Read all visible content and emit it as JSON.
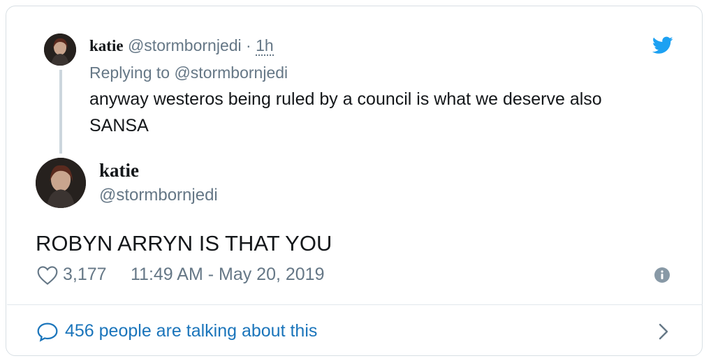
{
  "colors": {
    "brand": "#1da1f2",
    "link": "#1b75bb",
    "muted": "#657786",
    "text": "#14171a",
    "border": "#d8dfe4"
  },
  "quoted": {
    "name": "katie",
    "handle": "@stormbornjedi",
    "separator": "·",
    "time": "1h",
    "replying_to": "Replying to @stormbornjedi",
    "line1": "anyway westeros being ruled by a council is what we deserve also",
    "line2": "SANSA"
  },
  "main": {
    "name": "katie",
    "handle": "@stormbornjedi",
    "text": "ROBYN ARRYN IS THAT YOU",
    "likes": "3,177",
    "timestamp": "11:49 AM - May 20, 2019"
  },
  "footer": {
    "talking": "456 people are talking about this"
  },
  "icons": [
    "twitter-bird-icon",
    "heart-icon",
    "info-icon",
    "chat-bubble-icon",
    "chevron-right-icon"
  ]
}
